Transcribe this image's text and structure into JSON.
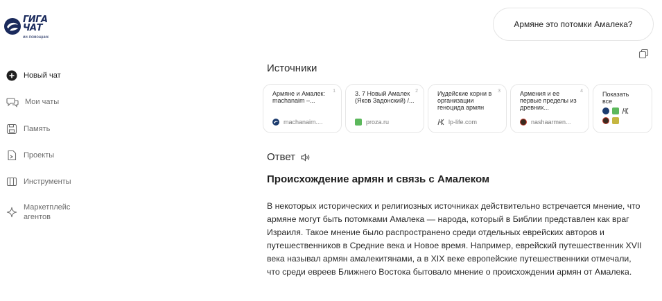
{
  "logo": {
    "word_line1": "ГИГА",
    "word_line2": "ЧАТ",
    "subtitle": "ии·помощник"
  },
  "sidebar": {
    "items": [
      {
        "label": "Новый чат",
        "icon": "plus-circle-icon",
        "active": true
      },
      {
        "label": "Мои чаты",
        "icon": "chat-bubbles-icon"
      },
      {
        "label": "Память",
        "icon": "floppy-disk-icon"
      },
      {
        "label": "Проекты",
        "icon": "project-file-icon"
      },
      {
        "label": "Инструменты",
        "icon": "tools-panel-icon"
      },
      {
        "label_line1": "Маркетплейс",
        "label_line2": "агентов",
        "icon": "sparkle-icon"
      }
    ]
  },
  "chat": {
    "user_message": "Армяне это потомки Амалека?",
    "sources_title": "Источники",
    "sources": [
      {
        "num": "1",
        "title": "Армяне и Амалек: machanaim –...",
        "site": "machanaim....",
        "favicon_color": "#1d3c6e"
      },
      {
        "num": "2",
        "title": "3. 7 Новый Амалек (Яков Задонский) /...",
        "site": "proza.ru",
        "favicon_color": "#5cb85c"
      },
      {
        "num": "3",
        "title": "Иудейские корни в организации геноцида армян",
        "site": "lp-life.com",
        "favicon_color": "#555555"
      },
      {
        "num": "4",
        "title": "Армения и ее первые пределы из древних...",
        "site": "nashaarmen...",
        "favicon_color": "#3a2a1f"
      }
    ],
    "show_all_label": "Показать все",
    "answer_title": "Ответ",
    "answer_heading": "Происхождение армян и связь с Амалеком",
    "answer_text": "В некоторых исторических и религиозных источниках действительно встречается мнение, что армяне могут быть потомками Амалека — народа, который в Библии представлен как враг Израиля. Такое мнение было распространено среди отдельных еврейских авторов и путешественников в Средние века и Новое время. Например, еврейский путешественник XVII века называл армян амалекитянами, а в XIX веке европейские путешественники отмечали, что среди евреев Ближнего Востока бытовало мнение о происхождении армян от Амалека."
  },
  "colors": {
    "brand": "#1a2a5c",
    "border": "#e4e4e4",
    "muted_text": "#6b6b6b"
  }
}
